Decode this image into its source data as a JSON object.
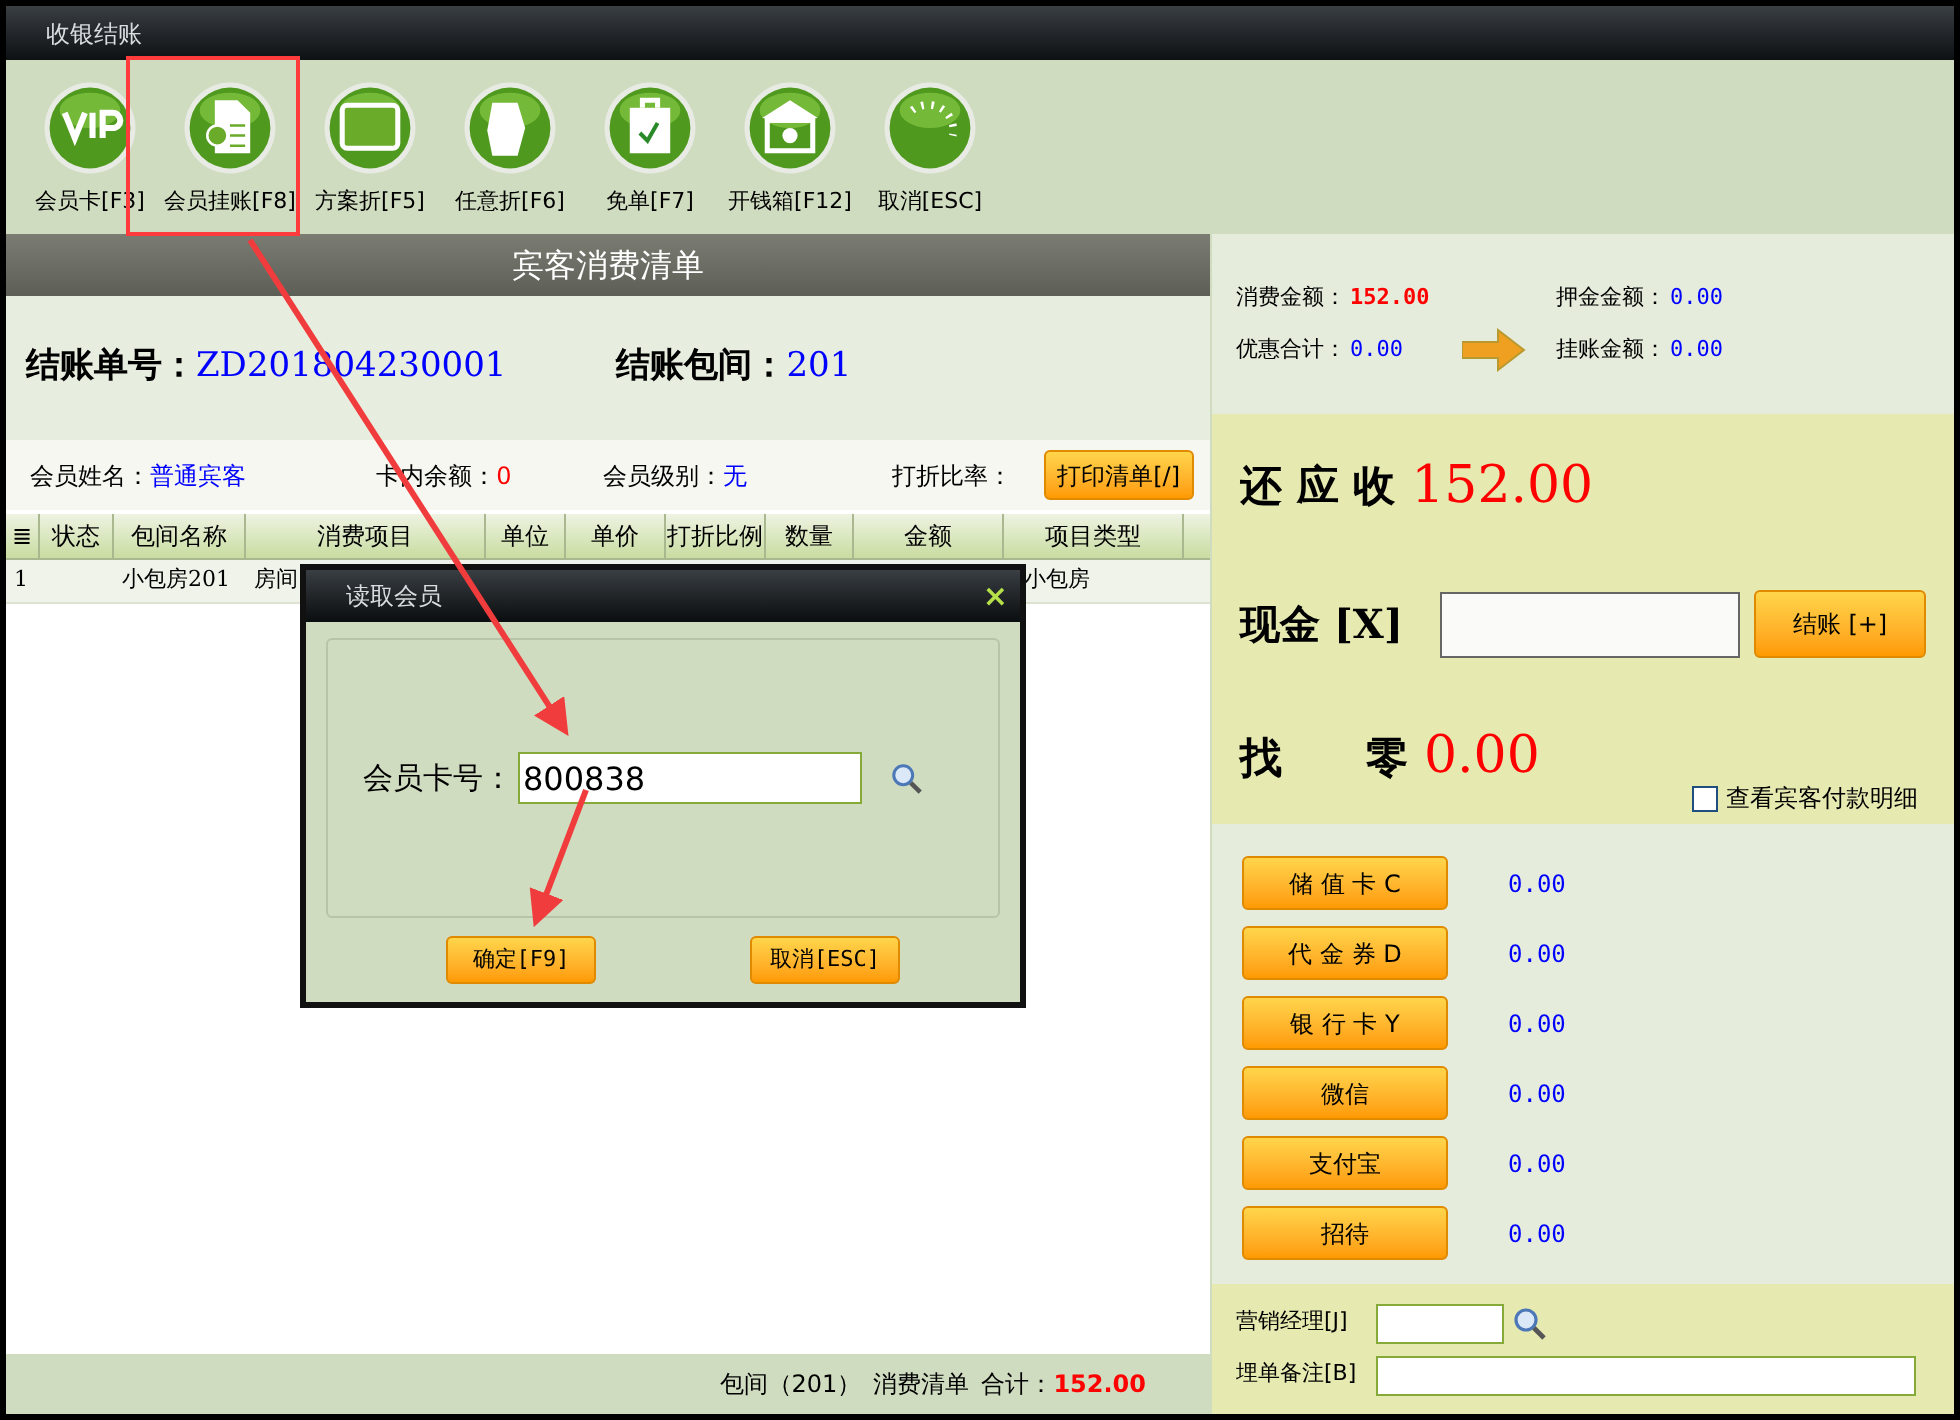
{
  "window": {
    "title": "收银结账"
  },
  "toolbar": [
    {
      "kind": "vip",
      "label": "会员卡[F3]"
    },
    {
      "kind": "doc",
      "label": "会员挂账[F8]"
    },
    {
      "kind": "screen",
      "label": "方案折[F5]"
    },
    {
      "kind": "cards",
      "label": "任意折[F6]"
    },
    {
      "kind": "bag",
      "label": "免单[F7]"
    },
    {
      "kind": "bank",
      "label": "开钱箱[F12]"
    },
    {
      "kind": "dots",
      "label": "取消[ESC]"
    }
  ],
  "bill": {
    "header": "宾客消费清单",
    "order_label": "结账单号：",
    "order_no": "ZD201804230001",
    "room_label": "结账包间：",
    "room": "201",
    "member": [
      {
        "label": "会员姓名：",
        "value": "普通宾客",
        "color": "#0000ff"
      },
      {
        "label": "卡内余额：",
        "value": "0",
        "color": "#ff0000"
      },
      {
        "label": "会员级别：",
        "value": "无",
        "color": "#0000ff"
      },
      {
        "label": "打折比率："
      }
    ],
    "print_button": "打印清单[/]"
  },
  "table": {
    "columns": [
      "≣",
      "状态",
      "包间名称",
      "消费项目",
      "单位",
      "单价",
      "打折比例",
      "数量",
      "金额",
      "项目类型"
    ],
    "rows": [
      [
        "1",
        "",
        "小包房201",
        "房间",
        "",
        "",
        "",
        "",
        "",
        "小包房"
      ]
    ]
  },
  "footer": {
    "room": "包间（201）",
    "list": "消费清单",
    "total_label": "合计：",
    "total": "152.00"
  },
  "summary": [
    {
      "label": "消费金额：",
      "value": "152.00",
      "color": "#ff0000"
    },
    {
      "label": "押金金额：",
      "value": "0.00",
      "color": "#0000ff"
    },
    {
      "label": "优惠合计：",
      "value": "0.00",
      "color": "#0000ff"
    },
    {
      "label": "挂账金额：",
      "value": "0.00",
      "color": "#0000ff"
    }
  ],
  "due": {
    "label": "还 应 收",
    "value": "152.00"
  },
  "cash": {
    "label": "现金 [X]",
    "button": "结账 [+]"
  },
  "change": {
    "label": "找　　零",
    "value": "0.00"
  },
  "show_detail": {
    "label": "查看宾客付款明细",
    "checked": false
  },
  "payments": [
    {
      "label": "储 值 卡 C",
      "value": "0.00"
    },
    {
      "label": "代 金 券 D",
      "value": "0.00"
    },
    {
      "label": "银 行 卡 Y",
      "value": "0.00"
    },
    {
      "label": "微信",
      "value": "0.00"
    },
    {
      "label": "支付宝",
      "value": "0.00"
    },
    {
      "label": "招待",
      "value": "0.00"
    }
  ],
  "manager": {
    "label": "营销经理[J]"
  },
  "note": {
    "label": "埋单备注[B]"
  },
  "dialog": {
    "title": "读取会员",
    "close": "×",
    "field_label": "会员卡号：",
    "field_value": "800838",
    "ok": "确定[F9]",
    "cancel": "取消[ESC]"
  }
}
